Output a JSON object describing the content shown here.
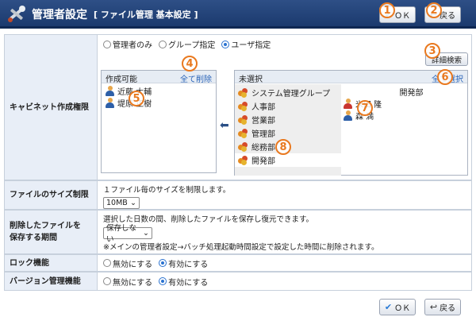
{
  "header": {
    "title": "管理者設定",
    "subtitle": "[ ファイル管理  基本設定 ]",
    "ok_label": "ＯＫ",
    "back_label": "戻る"
  },
  "markers": [
    "1",
    "2",
    "3",
    "4",
    "5",
    "6",
    "7",
    "8"
  ],
  "cabinet": {
    "label": "キャビネット作成権限",
    "radios": [
      "管理者のみ",
      "グループ指定",
      "ユーザ指定"
    ],
    "selected_radio": "ユーザ指定",
    "search_button": "詳細検索",
    "allowed_panel": {
      "title": "作成可能",
      "action": "全て削除",
      "users": [
        "近藤 大輔",
        "堤原 正樹"
      ]
    },
    "arrow": "⬅",
    "unselected_panel": {
      "title": "未選択",
      "action": "全て選択",
      "groups": [
        "システム管理グループ",
        "人事部",
        "営業部",
        "管理部",
        "総務部",
        "開発部"
      ],
      "selected_group": "開発部",
      "member_group_title": "開発部",
      "users": [
        "米田 隆",
        "森 満"
      ]
    }
  },
  "file_size": {
    "label": "ファイルのサイズ制限",
    "note": "１ファイル毎のサイズを制限します。",
    "value": "10MB"
  },
  "deleted_period": {
    "label_line1": "削除したファイルを",
    "label_line2": "保存する期間",
    "note": "選択した日数の間、削除したファイルを保存し復元できます。",
    "value": "保存しない",
    "note2": "※メインの管理者設定→バッチ処理起動時間設定で設定した時間に削除されます。"
  },
  "lock": {
    "label": "ロック機能",
    "off": "無効にする",
    "on": "有効にする",
    "selected": "有効にする"
  },
  "version": {
    "label": "バージョン管理機能",
    "off": "無効にする",
    "on": "有効にする",
    "selected": "有効にする"
  },
  "footer": {
    "ok_label": "ＯＫ",
    "back_label": "戻る"
  }
}
